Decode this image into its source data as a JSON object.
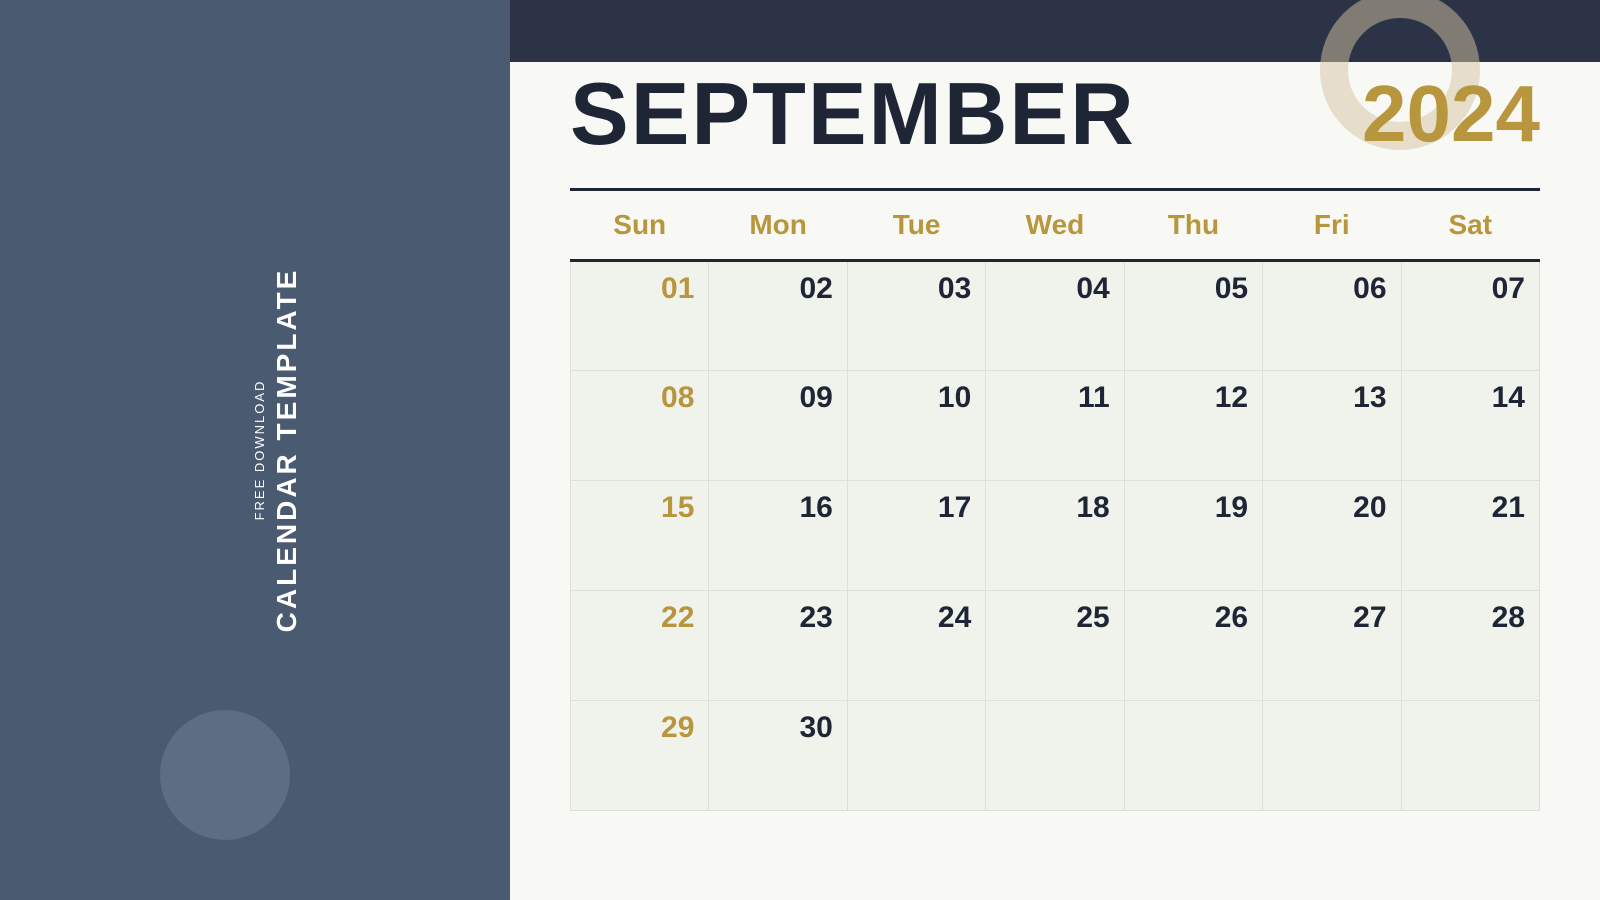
{
  "background_color": "#4a5a70",
  "side_label": {
    "free_download": "FREE DOWNLOAD",
    "calendar_template": "CALENDAR TEMPLATE"
  },
  "calendar": {
    "month": "SEPTEMBER",
    "year": "2024",
    "days_of_week": [
      "Sun",
      "Mon",
      "Tue",
      "Wed",
      "Thu",
      "Fri",
      "Sat"
    ],
    "weeks": [
      [
        "01",
        "02",
        "03",
        "04",
        "05",
        "06",
        "07"
      ],
      [
        "08",
        "09",
        "10",
        "11",
        "12",
        "13",
        "14"
      ],
      [
        "15",
        "16",
        "17",
        "18",
        "19",
        "20",
        "21"
      ],
      [
        "22",
        "23",
        "24",
        "25",
        "26",
        "27",
        "28"
      ],
      [
        "29",
        "30",
        "",
        "",
        "",
        "",
        ""
      ]
    ]
  }
}
